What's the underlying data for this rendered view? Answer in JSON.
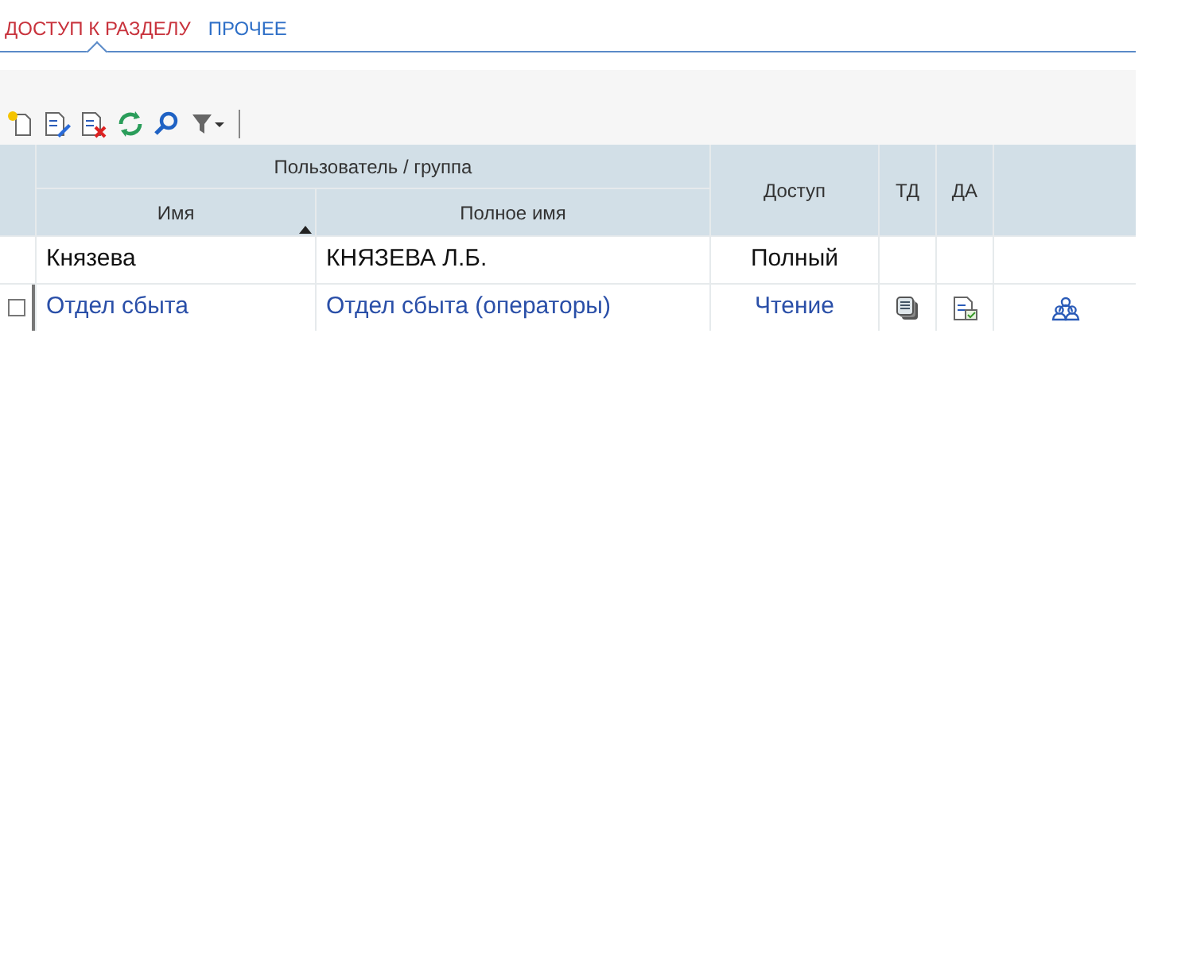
{
  "tabs": [
    {
      "label": "ДОСТУП К РАЗДЕЛУ",
      "selected": true
    },
    {
      "label": "ПРОЧЕЕ",
      "selected": false
    }
  ],
  "table": {
    "group_header": "Пользователь / группа",
    "columns": [
      {
        "label": "Имя",
        "sorted": true
      },
      {
        "label": "Полное имя",
        "sorted": false
      },
      {
        "label": "Доступ",
        "sorted": false
      },
      {
        "label": "ТД",
        "sorted": false
      },
      {
        "label": "ДА",
        "sorted": false
      }
    ],
    "rows": [
      {
        "kind": "user",
        "name": "Князева",
        "full_name": "КНЯЗЕВА Л.Б.",
        "access": "Полный"
      },
      {
        "kind": "group",
        "name": "Отдел сбыта",
        "full_name": "Отдел сбыта (операторы)",
        "access": "Чтение",
        "checked": false
      }
    ]
  }
}
